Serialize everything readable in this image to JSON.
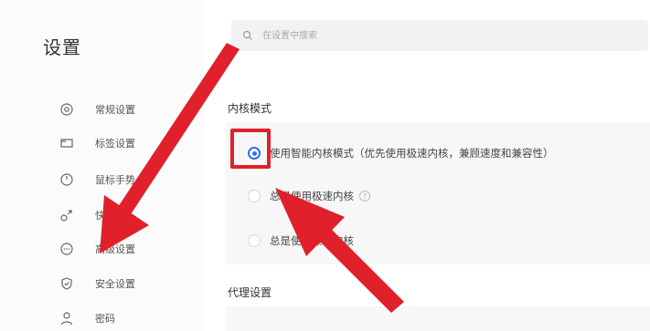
{
  "sidebar": {
    "title": "设置",
    "items": [
      {
        "label": "常规设置",
        "icon": "gear-icon"
      },
      {
        "label": "标签设置",
        "icon": "tab-icon"
      },
      {
        "label": "鼠标手势",
        "icon": "mouse-gesture-icon"
      },
      {
        "label": "快捷键",
        "icon": "shortcut-icon"
      },
      {
        "label": "高级设置",
        "icon": "advanced-icon"
      },
      {
        "label": "安全设置",
        "icon": "shield-icon"
      },
      {
        "label": "密码",
        "icon": "user-icon"
      }
    ]
  },
  "search": {
    "placeholder": "在设置中搜索"
  },
  "kernel": {
    "title": "内核模式",
    "options": [
      {
        "label": "使用智能内核模式（优先使用极速内核，兼顾速度和兼容性）",
        "checked": true
      },
      {
        "label": "总是使用极速内核",
        "checked": false,
        "has_help": true
      },
      {
        "label": "总是使用兼容内核",
        "checked": false
      }
    ]
  },
  "proxy": {
    "title": "代理设置"
  },
  "colors": {
    "accent": "#2f6fe4",
    "annotation": "#e0202a"
  }
}
